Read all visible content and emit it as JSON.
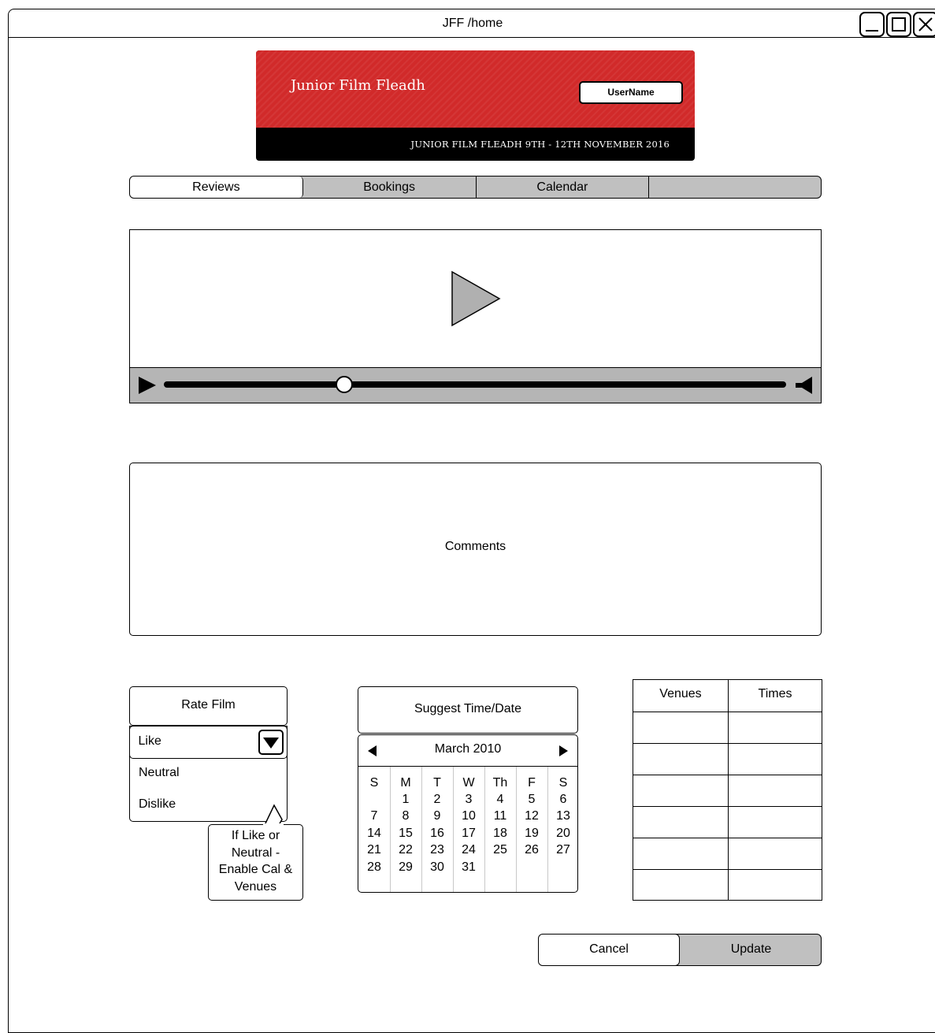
{
  "window": {
    "title": "JFF /home",
    "controls": [
      "minimize-icon",
      "maximize-icon",
      "close-icon"
    ]
  },
  "header": {
    "brand": "Junior Film Fleadh",
    "username": "UserName",
    "subtitle": "JUNIOR FILM FLEADH  9TH - 12TH  NOVEMBER 2016",
    "colors": {
      "banner_red": "#d12a2a",
      "banner_black": "#000000"
    }
  },
  "tabs": [
    {
      "label": "Reviews",
      "active": true
    },
    {
      "label": "Bookings",
      "active": false
    },
    {
      "label": "Calendar",
      "active": false
    },
    {
      "label": "",
      "active": false
    }
  ],
  "player": {
    "icons": [
      "play-large-icon",
      "play-icon",
      "volume-icon"
    ],
    "progress": 0.29
  },
  "comments": {
    "label": "Comments"
  },
  "rating": {
    "button_label": "Rate Film",
    "selected": "Like",
    "options": [
      "Neutral",
      "Dislike"
    ],
    "note": [
      "If Like or",
      "Neutral -",
      "Enable Cal &",
      "Venues"
    ]
  },
  "calendar": {
    "button_label": "Suggest Time/Date",
    "month": "March 2010",
    "weekdays": [
      "S",
      "M",
      "T",
      "W",
      "Th",
      "F",
      "S"
    ],
    "weeks": [
      [
        "",
        "1",
        "2",
        "3",
        "4",
        "5",
        "6"
      ],
      [
        "7",
        "8",
        "9",
        "10",
        "11",
        "12",
        "13"
      ],
      [
        "14",
        "15",
        "16",
        "17",
        "18",
        "19",
        "20"
      ],
      [
        "21",
        "22",
        "23",
        "24",
        "25",
        "26",
        "27"
      ],
      [
        "28",
        "29",
        "30",
        "31",
        "",
        "",
        ""
      ]
    ]
  },
  "venues_table": {
    "columns": [
      "Venues",
      "Times"
    ],
    "rows": [
      [
        "",
        ""
      ],
      [
        "",
        ""
      ],
      [
        "",
        ""
      ],
      [
        "",
        ""
      ],
      [
        "",
        ""
      ],
      [
        "",
        ""
      ]
    ]
  },
  "actions": {
    "cancel": "Cancel",
    "update": "Update"
  }
}
